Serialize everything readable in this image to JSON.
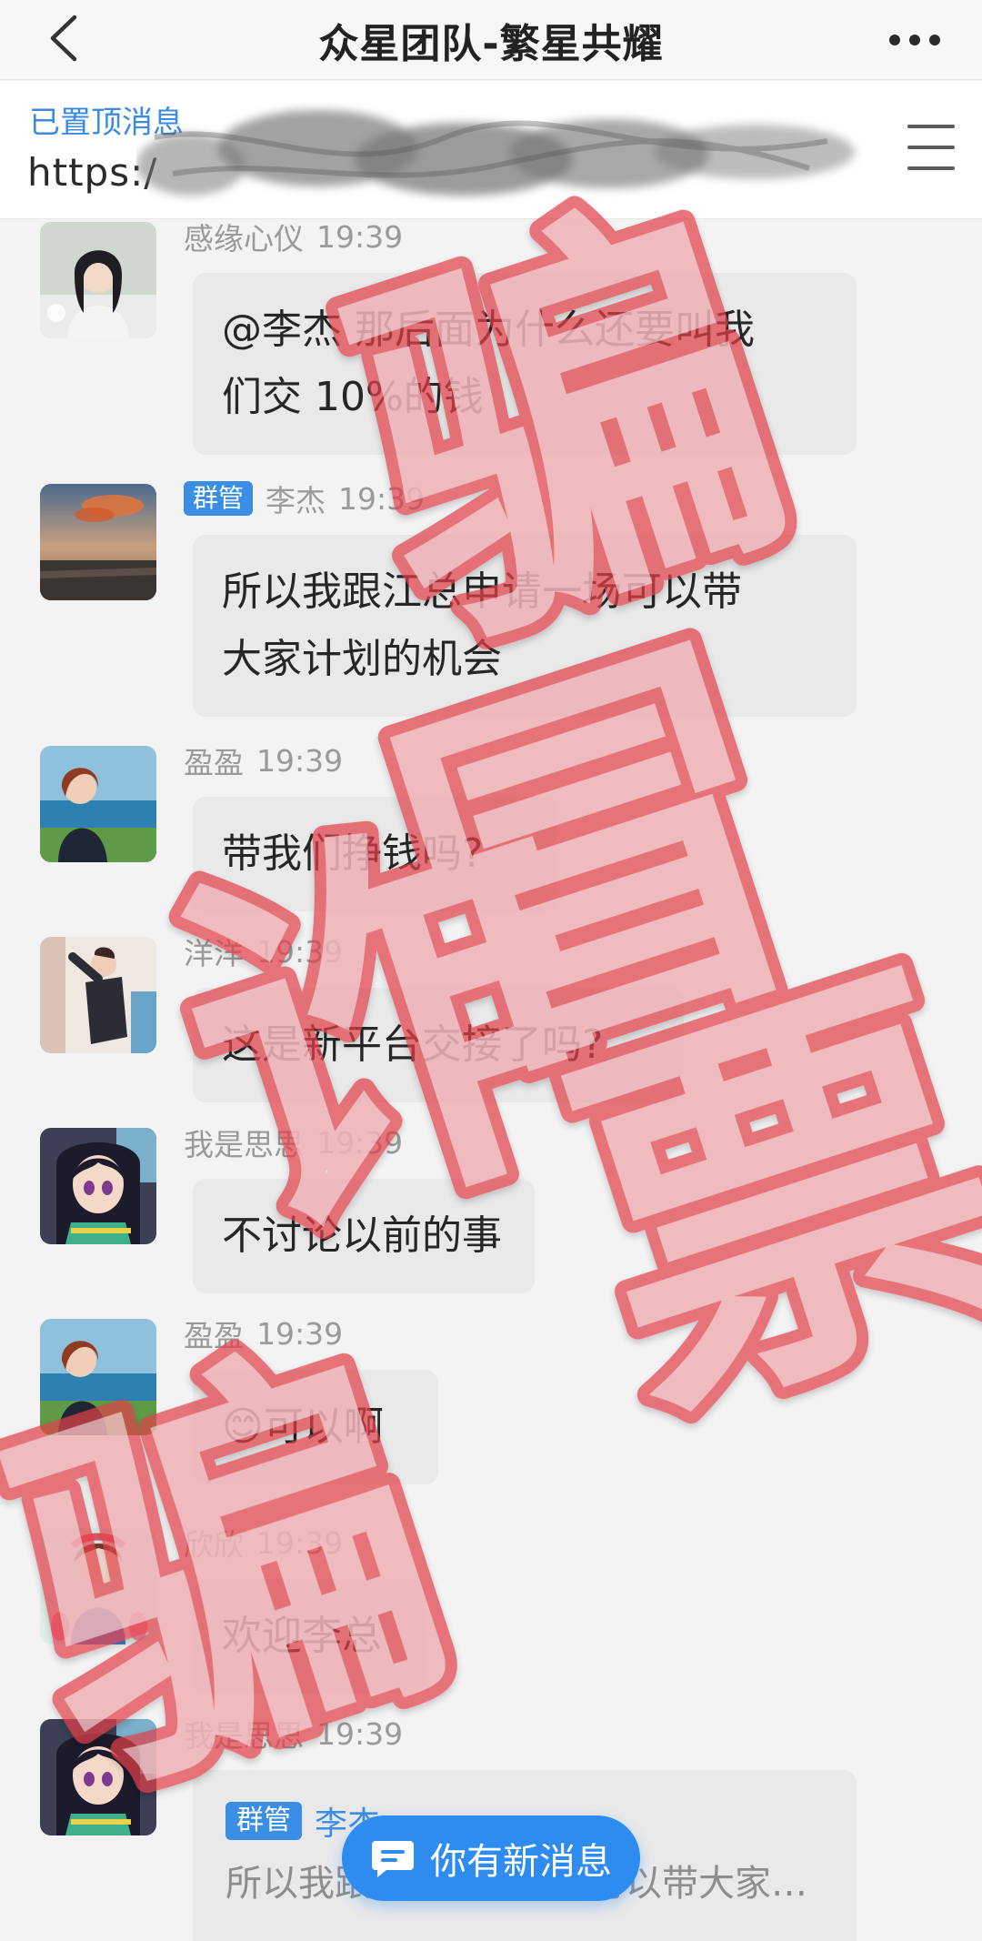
{
  "header": {
    "title": "众星团队-繁星共耀"
  },
  "pinned": {
    "label": "已置顶消息",
    "url_prefix": "https:/"
  },
  "messages": [
    {
      "sender": "感缘心仪",
      "time": "19:39",
      "role": "",
      "lines": [
        "@李杰 那后面为什么还要叫我",
        "们交 10%的钱"
      ]
    },
    {
      "sender": "李杰",
      "time": "19:39",
      "role": "群管",
      "lines": [
        "所以我跟江总申请一场可以带",
        "大家计划的机会"
      ]
    },
    {
      "sender": "盈盈",
      "time": "19:39",
      "role": "",
      "lines": [
        "带我们挣钱吗?"
      ]
    },
    {
      "sender": "洋洋",
      "time": "19:39",
      "role": "",
      "lines": [
        "这是新平台交接了吗?"
      ]
    },
    {
      "sender": "我是思思",
      "time": "19:39",
      "role": "",
      "lines": [
        "不讨论以前的事"
      ]
    },
    {
      "sender": "盈盈",
      "time": "19:39",
      "role": "",
      "emoji": "😊",
      "lines": [
        "可以啊"
      ]
    },
    {
      "sender": "欣欣",
      "time": "19:39",
      "role": "",
      "lines": [
        "欢迎李总"
      ]
    },
    {
      "sender": "我是思思",
      "time": "19:39",
      "role": "",
      "quote": {
        "badge": "群管",
        "name": "李杰:",
        "text": "所以我跟江总申请一场可以带大家…"
      }
    }
  ],
  "new_message_pill": {
    "label": "你有新消息"
  },
  "watermark": {
    "text": "骗子 假冒 诈骗",
    "color": "#e0404a"
  },
  "colors": {
    "accent": "#3a8ee6",
    "bubble": "#e9e9ea",
    "background": "#f3f3f4"
  }
}
